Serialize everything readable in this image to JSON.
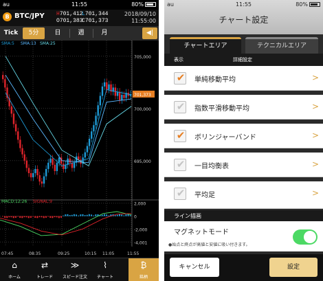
{
  "left": {
    "status": {
      "carrier": "au",
      "time": "11:55",
      "battery": "80%"
    },
    "header": {
      "pair": "BTC/JPY",
      "coin_symbol": "B",
      "h_label": "H",
      "h_value": "701,412",
      "l_label": "L",
      "l_value": "701,344",
      "o_label": "O",
      "o_value": "701,383",
      "c_label": "C",
      "c_value": "701,373",
      "date": "2018/09/10",
      "time": "11:55:00"
    },
    "tabs": [
      "Tick",
      "5分",
      "日",
      "週",
      "月"
    ],
    "active_tab": "5分",
    "toggle_icon": "◀|",
    "legend": {
      "sma5": "SMA:5",
      "sma13": "SMA:13",
      "sma25": "SMA:25",
      "macd": "MACD:12:26",
      "signal": "SIGNAL:9"
    },
    "price_labels": [
      "705,000",
      "700,000",
      "695,000"
    ],
    "current_price": "701,373",
    "macd_labels": [
      "2,000",
      "0",
      "-2,000",
      "-4,001"
    ],
    "time_labels": [
      "07:45",
      "08:35",
      "09:25",
      "10:15",
      "11:05",
      "11:55"
    ],
    "nav": [
      {
        "label": "ホーム",
        "icon": "⌂"
      },
      {
        "label": "トレード",
        "icon": "⇄"
      },
      {
        "label": "スピード注文",
        "icon": "≫"
      },
      {
        "label": "チャート",
        "icon": "⌇"
      },
      {
        "label": "銘柄",
        "icon": "₿"
      }
    ],
    "colors": {
      "accent": "#d9a443",
      "up": "#1e9bd7",
      "down": "#e0242b"
    }
  },
  "right": {
    "status": {
      "carrier": "au",
      "time": "11:55",
      "battery": "80%"
    },
    "title": "チャート設定",
    "tabs": {
      "chart_area": "チャートエリア",
      "technical_area": "テクニカルエリア"
    },
    "col_display": "表示",
    "col_detail": "詳細設定",
    "items": [
      {
        "label": "単純移動平均",
        "checked": true
      },
      {
        "label": "指数平滑移動平均",
        "checked": false
      },
      {
        "label": "ボリンジャーバンド",
        "checked": true
      },
      {
        "label": "一目均衡表",
        "checked": false
      },
      {
        "label": "平均足",
        "checked": false
      }
    ],
    "section_line": "ライン描画",
    "magnet_label": "マグネットモード",
    "magnet_note": "●始点と終点が高値と安値に吸い付きます。",
    "magnet_on": true,
    "cancel": "キャンセル",
    "settings": "設定"
  },
  "chart_data": {
    "type": "line",
    "x": [
      "07:45",
      "08:35",
      "09:25",
      "10:15",
      "11:05",
      "11:55"
    ],
    "y_axis_labels": [
      705000,
      700000,
      695000
    ],
    "current_price": 701373,
    "high": 701412,
    "low": 701344,
    "open": 701383,
    "close": 701373,
    "series": [
      {
        "name": "SMA:5",
        "values": [
          701500,
          697000,
          694500,
          695200,
          701800,
          701300
        ]
      },
      {
        "name": "SMA:13",
        "values": [
          703200,
          699000,
          695000,
          694800,
          700600,
          700900
        ]
      },
      {
        "name": "SMA:25",
        "values": [
          705000,
          700500,
          696000,
          694500,
          698500,
          700200
        ]
      }
    ],
    "macd_axis_labels": [
      2000,
      0,
      -2000,
      -4001
    ]
  }
}
